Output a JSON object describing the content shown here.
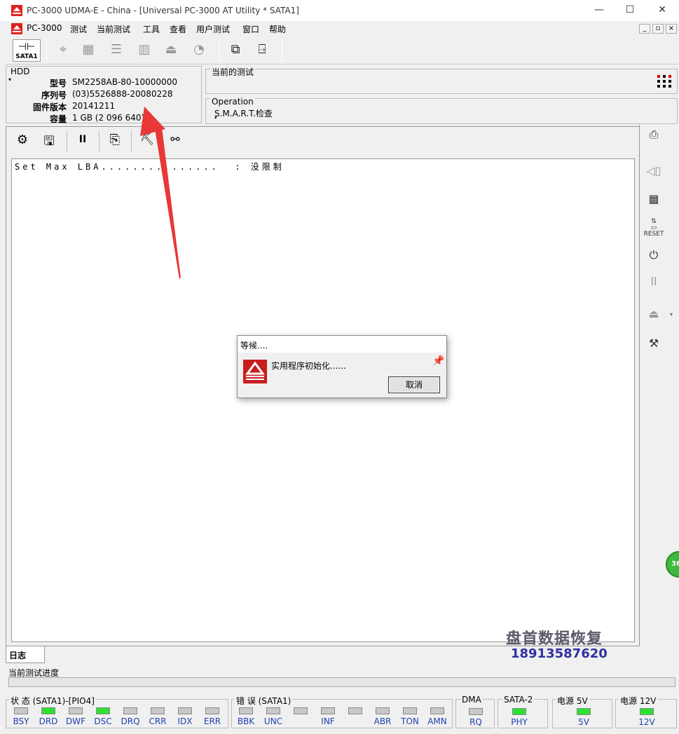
{
  "window": {
    "title": "PC-3000 UDMA-E - China - [Universal PC-3000 AT Utility * SATA1]",
    "minimize": "—",
    "maximize": "☐",
    "close": "✕"
  },
  "menu": [
    "PC-3000",
    "测试",
    "当前测试",
    "工具",
    "查看",
    "用户测试",
    "窗口",
    "帮助"
  ],
  "toolbar": {
    "sata_label": "SATA1"
  },
  "hdd": {
    "group_label": "HDD",
    "model_label": "型号",
    "model": "SM2258AB-80-10000000",
    "serial_label": "序列号",
    "serial": "(03)5526888-20080228",
    "firmware_label": "固件版本",
    "firmware": "20141211",
    "capacity_label": "容量",
    "capacity": "1 GB (2 096 640)"
  },
  "current_test": {
    "label": "当前的测试"
  },
  "operation": {
    "label": "Operation",
    "value": "S.M.A.R.T.检查"
  },
  "log": {
    "line": "Set Max LBA...............  : 没限制",
    "tab": "日志"
  },
  "progress": {
    "label": "当前测试进度",
    "value": 0
  },
  "dialog": {
    "title": "等候....",
    "message": "实用程序初始化......",
    "cancel": "取消"
  },
  "status": {
    "group_label": "状 态 (SATA1)-[PIO4]",
    "leds": [
      {
        "name": "BSY",
        "on": false
      },
      {
        "name": "DRD",
        "on": true
      },
      {
        "name": "DWF",
        "on": false
      },
      {
        "name": "DSC",
        "on": true
      },
      {
        "name": "DRQ",
        "on": false
      },
      {
        "name": "CRR",
        "on": false
      },
      {
        "name": "IDX",
        "on": false
      },
      {
        "name": "ERR",
        "on": false
      }
    ]
  },
  "errors": {
    "group_label": "错 误 (SATA1)",
    "leds": [
      {
        "name": "BBK",
        "on": false
      },
      {
        "name": "UNC",
        "on": false
      },
      {
        "name": "",
        "on": false
      },
      {
        "name": "INF",
        "on": false
      },
      {
        "name": "",
        "on": false
      },
      {
        "name": "ABR",
        "on": false
      },
      {
        "name": "TON",
        "on": false
      },
      {
        "name": "AMN",
        "on": false
      }
    ]
  },
  "dma": {
    "group_label": "DMA",
    "led": "RQ",
    "on": false
  },
  "sata2": {
    "group_label": "SATA-2",
    "led": "PHY",
    "on": true
  },
  "power5": {
    "group_label": "电源 5V",
    "led": "5V",
    "on": true
  },
  "power12": {
    "group_label": "电源 12V",
    "led": "12V",
    "on": true
  },
  "watermark": {
    "name": "盘首数据恢复",
    "phone": "18913587620"
  },
  "badge": {
    "text": "36"
  },
  "colors": {
    "led_on": "#2ee02e",
    "led_label": "#2040b0",
    "arrow": "#e83838"
  }
}
